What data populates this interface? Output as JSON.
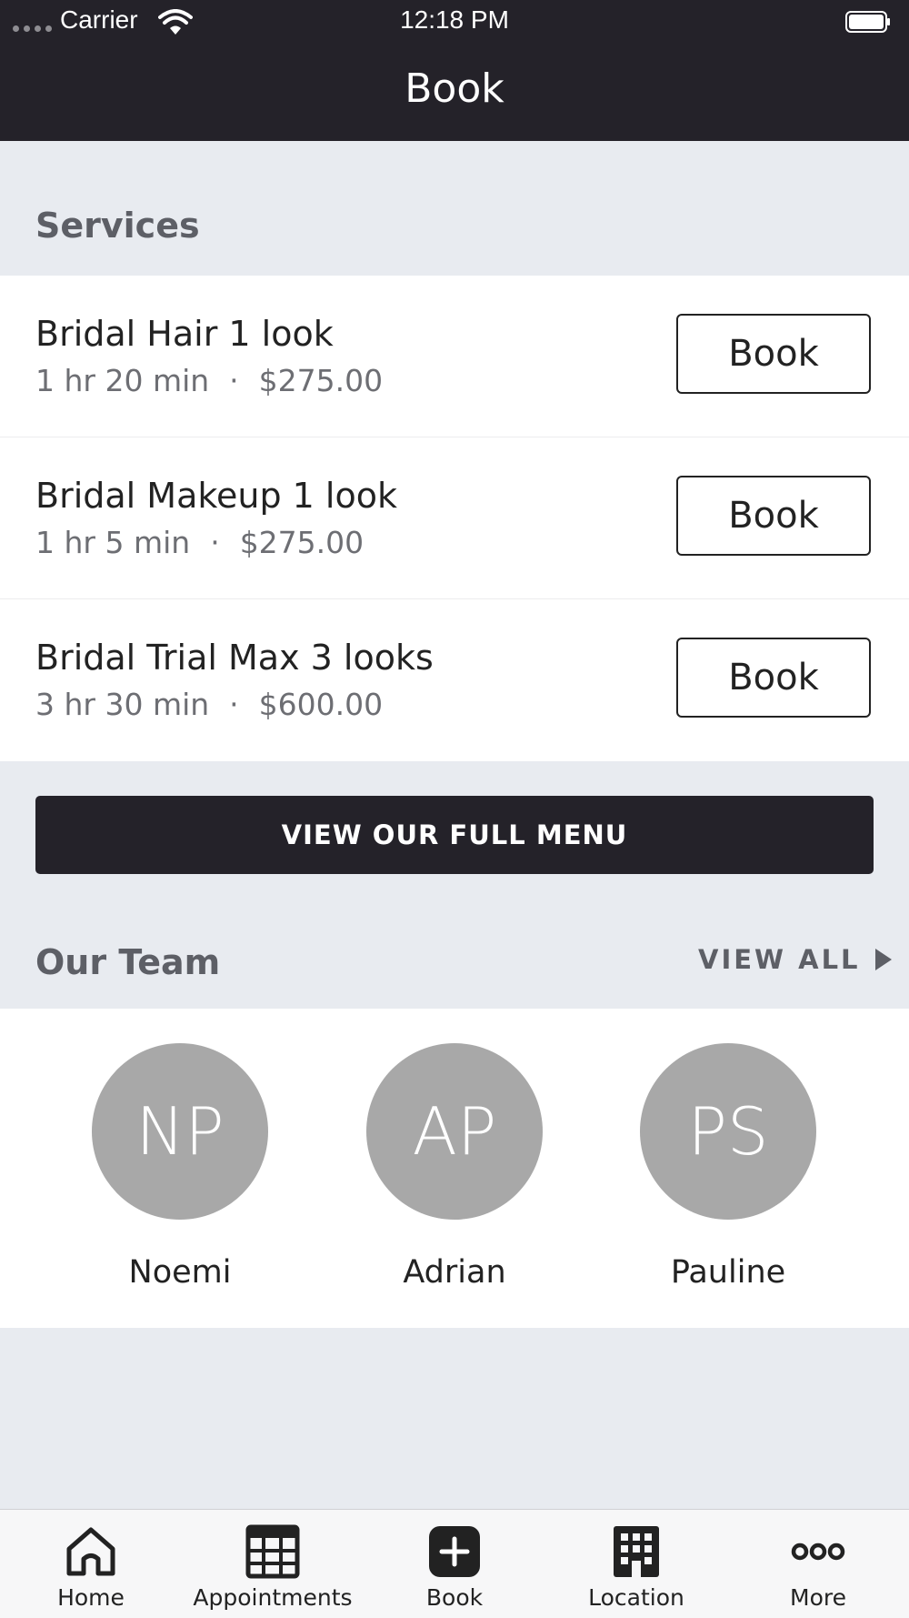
{
  "status_bar": {
    "carrier": "Carrier",
    "time": "12:18 PM"
  },
  "header": {
    "title": "Book"
  },
  "services": {
    "label": "Services",
    "items": [
      {
        "name": "Bridal Hair 1  look",
        "duration": "1 hr 20 min",
        "separator": "·",
        "price": "$275.00",
        "button": "Book"
      },
      {
        "name": "Bridal Makeup 1 look",
        "duration": "1 hr 5 min",
        "separator": "·",
        "price": "$275.00",
        "button": "Book"
      },
      {
        "name": "Bridal Trial  Max 3 looks",
        "duration": "3 hr 30 min",
        "separator": "·",
        "price": "$600.00",
        "button": "Book"
      }
    ]
  },
  "menu_button": "VIEW OUR FULL MENU",
  "team": {
    "label": "Our Team",
    "view_all": "VIEW ALL",
    "members": [
      {
        "initials": "NP",
        "name": "Noemi"
      },
      {
        "initials": "AP",
        "name": "Adrian"
      },
      {
        "initials": "PS",
        "name": "Pauline"
      }
    ]
  },
  "tabs": [
    {
      "label": "Home",
      "icon": "home-icon"
    },
    {
      "label": "Appointments",
      "icon": "calendar-grid-icon"
    },
    {
      "label": "Book",
      "icon": "plus-square-icon"
    },
    {
      "label": "Location",
      "icon": "building-icon"
    },
    {
      "label": "More",
      "icon": "more-dots-icon"
    }
  ],
  "colors": {
    "header_bg": "#242229",
    "page_bg": "#e8ebf0",
    "avatar_bg": "#a8a8a8",
    "text": "#222222",
    "muted": "#5d5f66"
  }
}
